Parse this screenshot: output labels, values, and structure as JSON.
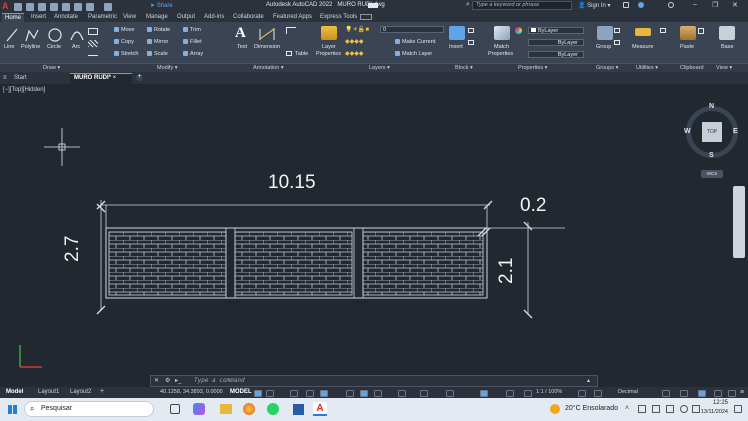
{
  "title_bar": {
    "app_title": "Autodesk AutoCAD 2022",
    "file_name": "MURO RUDI.dwg",
    "share": "Share",
    "search_placeholder": "Type a keyword or phrase",
    "sign_in": "Sign In"
  },
  "ribbon_tabs": [
    "Home",
    "Insert",
    "Annotate",
    "Parametric",
    "View",
    "Manage",
    "Output",
    "Add-ins",
    "Collaborate",
    "Featured Apps",
    "Express Tools"
  ],
  "ribbon": {
    "draw": {
      "line": "Line",
      "polyline": "Polyline",
      "circle": "Circle",
      "arc": "Arc"
    },
    "modify": {
      "move": "Move",
      "rotate": "Rotate",
      "trim": "Trim",
      "copy": "Copy",
      "mirror": "Mirror",
      "fillet": "Fillet",
      "stretch": "Stretch",
      "scale": "Scale",
      "array": "Array"
    },
    "annotation": {
      "text": "Text",
      "dimension": "Dimension",
      "table": "Table"
    },
    "layers": {
      "layer_properties_1": "Layer",
      "layer_properties_2": "Properties",
      "layer_value": "0",
      "make_current": "Make Current",
      "match_layer": "Match Layer"
    },
    "block": {
      "insert": "Insert"
    },
    "properties": {
      "match_1": "Match",
      "match_2": "Properties",
      "color": "ByLayer",
      "linetype": "ByLayer",
      "lineweight": "ByLayer"
    },
    "groups": {
      "group": "Group"
    },
    "utilities": {
      "measure": "Measure"
    },
    "clipboard": {
      "paste": "Paste"
    },
    "view": {
      "base": "Base"
    }
  },
  "panel_labels": {
    "draw": "Draw ▾",
    "modify": "Modify ▾",
    "annotation": "Annotation ▾",
    "layers": "Layers ▾",
    "block": "Block ▾",
    "properties": "Properties ▾",
    "groups": "Groups ▾",
    "utilities": "Utilities ▾",
    "clipboard": "Clipboard",
    "view": "View ▾"
  },
  "doc_tabs": {
    "start": "Start",
    "active": "MURO RUDI*"
  },
  "viewport": {
    "label": "[−][Top][Hidden]"
  },
  "viewcube": {
    "n": "N",
    "s": "S",
    "e": "E",
    "w": "W",
    "top": "TOP",
    "wcs": "WCS"
  },
  "drawing": {
    "dim_width": "10.15",
    "dim_height": "2.7",
    "dim_thickness": "0.2",
    "dim_inner_height": "2.1"
  },
  "command": {
    "placeholder": "Type a command"
  },
  "layouts": [
    "Model",
    "Layout1",
    "Layout2"
  ],
  "status": {
    "coords": "40.1258, 34.3893, 0.0000",
    "model": "MODEL",
    "scale": "1:1 / 100%",
    "units": "Decimal"
  },
  "taskbar": {
    "search": "Pesquisar",
    "weather": "20°C Ensolarado",
    "time": "12:25",
    "date": "13/11/2024"
  },
  "colors": {
    "canvas": "#212830",
    "ribbon": "#3b4453",
    "accent": "#5fa3e8",
    "wall_line": "#cfd6de"
  }
}
